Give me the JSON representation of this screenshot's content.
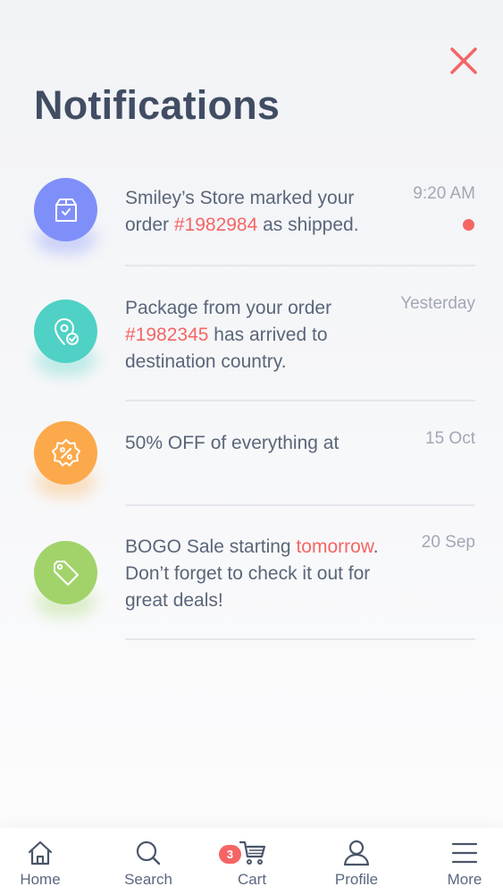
{
  "header": {
    "title": "Notifications"
  },
  "colors": {
    "accent": "#f56565",
    "title": "#414d63"
  },
  "notifications": [
    {
      "icon": "package-icon",
      "color": "#7c8cf8",
      "segments": [
        {
          "t": "Smiley’s Store",
          "s": "b"
        },
        {
          "t": " marked your order ",
          "s": ""
        },
        {
          "t": "#1982984",
          "s": "hl"
        },
        {
          "t": " as ",
          "s": ""
        },
        {
          "t": "shipped",
          "s": "b"
        },
        {
          "t": ".",
          "s": ""
        }
      ],
      "time": "9:20 AM",
      "unread": true
    },
    {
      "icon": "location-check-icon",
      "color": "#4fd1c5",
      "segments": [
        {
          "t": "Package from your order ",
          "s": ""
        },
        {
          "t": "#1982345",
          "s": "hl"
        },
        {
          "t": " has ",
          "s": ""
        },
        {
          "t": "arrived to destination country",
          "s": "b"
        },
        {
          "t": ".",
          "s": ""
        }
      ],
      "time": "Yesterday",
      "unread": false
    },
    {
      "icon": "discount-badge-icon",
      "color": "#fbab4a",
      "segments": [
        {
          "t": "50% OFF",
          "s": "b"
        },
        {
          "t": " of everything at",
          "s": ""
        }
      ],
      "time": "15 Oct",
      "unread": false
    },
    {
      "icon": "tag-icon",
      "color": "#a0d468",
      "segments": [
        {
          "t": "BOGO Sale",
          "s": "b"
        },
        {
          "t": " starting ",
          "s": ""
        },
        {
          "t": "tomorrow",
          "s": "hl"
        },
        {
          "t": ". Don’t forget to check it out for ",
          "s": ""
        },
        {
          "t": "great deals!",
          "s": "b"
        }
      ],
      "time": "20 Sep",
      "unread": false
    }
  ],
  "tabbar": {
    "items": [
      {
        "label": "Home",
        "icon": "home-icon"
      },
      {
        "label": "Search",
        "icon": "search-icon"
      },
      {
        "label": "Cart",
        "icon": "cart-icon",
        "badge": "3"
      },
      {
        "label": "Profile",
        "icon": "user-icon"
      },
      {
        "label": "More",
        "icon": "menu-icon"
      }
    ]
  }
}
